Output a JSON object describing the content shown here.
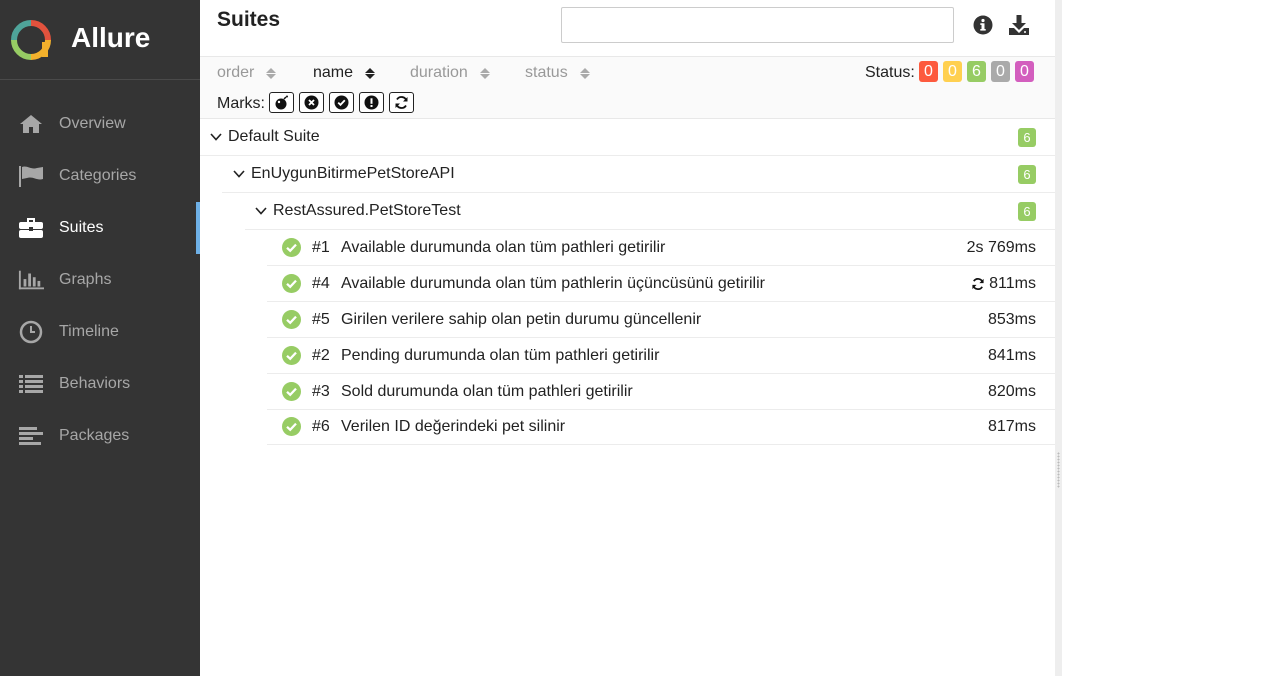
{
  "app": {
    "name": "Allure"
  },
  "sidebar": {
    "items": [
      {
        "label": "Overview",
        "icon": "home-icon",
        "active": false
      },
      {
        "label": "Categories",
        "icon": "flag-icon",
        "active": false
      },
      {
        "label": "Suites",
        "icon": "briefcase-icon",
        "active": true
      },
      {
        "label": "Graphs",
        "icon": "bar-chart-icon",
        "active": false
      },
      {
        "label": "Timeline",
        "icon": "clock-icon",
        "active": false
      },
      {
        "label": "Behaviors",
        "icon": "list-icon",
        "active": false
      },
      {
        "label": "Packages",
        "icon": "align-left-icon",
        "active": false
      }
    ]
  },
  "header": {
    "title": "Suites",
    "search_value": ""
  },
  "sorters": [
    {
      "label": "order",
      "active": false
    },
    {
      "label": "name",
      "active": true
    },
    {
      "label": "duration",
      "active": false
    },
    {
      "label": "status",
      "active": false
    }
  ],
  "status_filter": {
    "label": "Status:",
    "badges": [
      {
        "value": "0",
        "color": "#fd5a3e",
        "status": "failed"
      },
      {
        "value": "0",
        "color": "#ffd050",
        "status": "broken"
      },
      {
        "value": "6",
        "color": "#97cc64",
        "status": "passed"
      },
      {
        "value": "0",
        "color": "#aaaaaa",
        "status": "skipped"
      },
      {
        "value": "0",
        "color": "#d35ebe",
        "status": "unknown"
      }
    ]
  },
  "marks": {
    "label": "Marks:",
    "items": [
      "bomb-icon",
      "times-circle-icon",
      "check-circle-icon",
      "exclamation-circle-icon",
      "refresh-icon"
    ]
  },
  "tree": {
    "suite": {
      "name": "Default Suite",
      "count": "6"
    },
    "package": {
      "name": "EnUygunBitirmePetStoreAPI",
      "count": "6"
    },
    "class": {
      "name": "RestAssured.PetStoreTest",
      "count": "6"
    },
    "tests": [
      {
        "num": "#1",
        "name": "Available durumunda olan tüm pathleri getirilir",
        "duration": "2s 769ms",
        "retried": false
      },
      {
        "num": "#4",
        "name": "Available durumunda olan tüm pathlerin üçüncüsünü getirilir",
        "duration": "811ms",
        "retried": true
      },
      {
        "num": "#5",
        "name": "Girilen verilere sahip olan petin durumu güncellenir",
        "duration": "853ms",
        "retried": false
      },
      {
        "num": "#2",
        "name": "Pending durumunda olan tüm pathleri getirilir",
        "duration": "841ms",
        "retried": false
      },
      {
        "num": "#3",
        "name": "Sold durumunda olan tüm pathleri getirilir",
        "duration": "820ms",
        "retried": false
      },
      {
        "num": "#6",
        "name": "Verilen ID değerindeki pet silinir",
        "duration": "817ms",
        "retried": false
      }
    ]
  }
}
